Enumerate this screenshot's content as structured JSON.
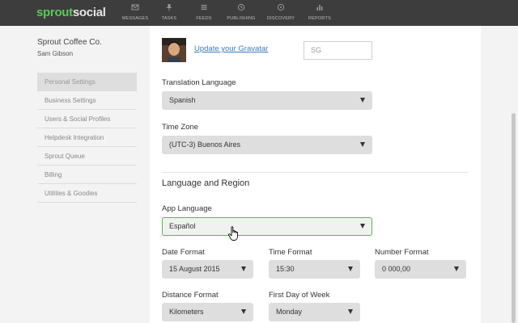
{
  "brand": {
    "part1": "sprout",
    "part2": "social"
  },
  "nav": [
    {
      "label": "MESSAGES",
      "icon": "envelope-icon"
    },
    {
      "label": "TASKS",
      "icon": "pin-icon"
    },
    {
      "label": "FEEDS",
      "icon": "feeds-icon"
    },
    {
      "label": "PUBLISHING",
      "icon": "paper-plane-icon"
    },
    {
      "label": "DISCOVERY",
      "icon": "discovery-icon"
    },
    {
      "label": "REPORTS",
      "icon": "bar-chart-icon"
    }
  ],
  "sidebar": {
    "company": "Sprout Coffee Co.",
    "user": "Sam Gibson",
    "items": [
      {
        "label": "Personal Settings",
        "active": true
      },
      {
        "label": "Business Settings"
      },
      {
        "label": "Users & Social Profiles"
      },
      {
        "label": "Helpdesk Integration"
      },
      {
        "label": "Sprout Queue"
      },
      {
        "label": "Billing"
      },
      {
        "label": "Utilities & Goodies"
      }
    ]
  },
  "profile": {
    "gravatar_link": "Update your Gravatar",
    "initials": "SG"
  },
  "settings": {
    "translation_language": {
      "label": "Translation Language",
      "value": "Spanish"
    },
    "time_zone": {
      "label": "Time Zone",
      "value": "(UTC-3) Buenos Aires"
    },
    "section_title": "Language and Region",
    "app_language": {
      "label": "App Language",
      "value": "Español"
    },
    "date_format": {
      "label": "Date Format",
      "value": "15 August 2015"
    },
    "time_format": {
      "label": "Time Format",
      "value": "15:30"
    },
    "number_format": {
      "label": "Number Format",
      "value": "0 000,00"
    },
    "distance_format": {
      "label": "Distance Format",
      "value": "Kilometers"
    },
    "first_day": {
      "label": "First Day of Week",
      "value": "Monday"
    }
  },
  "colors": {
    "accent": "#58b84a",
    "link": "#3a7bbf",
    "topbar": "#3d3d3d"
  }
}
